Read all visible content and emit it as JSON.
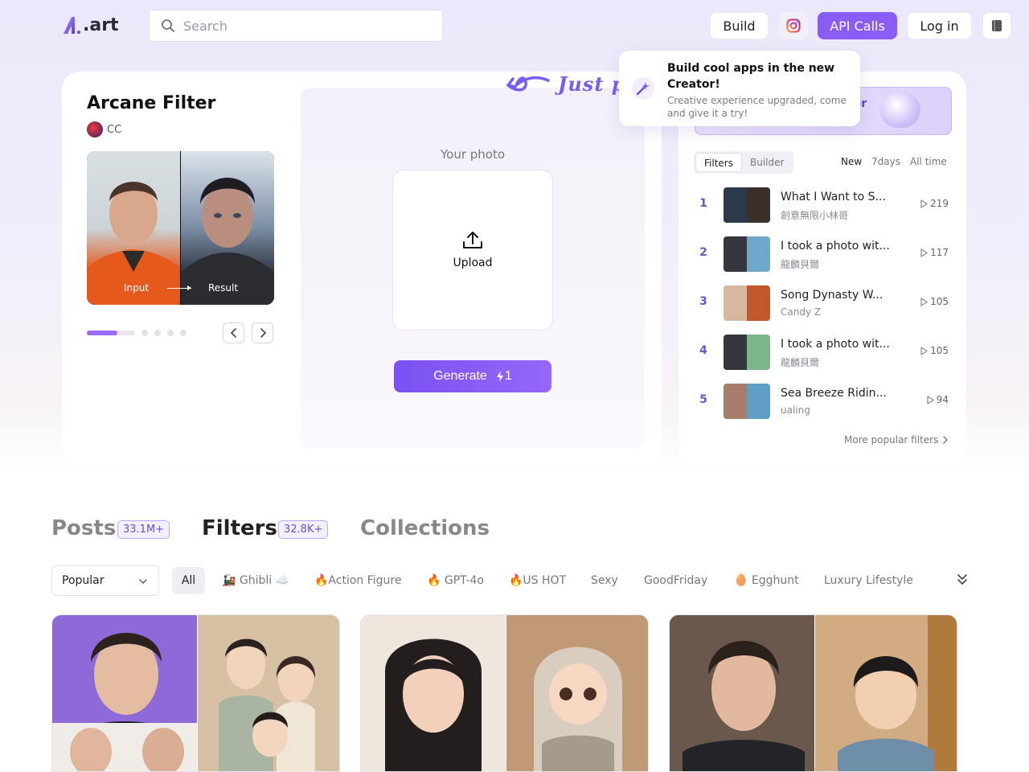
{
  "header": {
    "logo_text": ".art",
    "search_placeholder": "Search",
    "build_label": "Build",
    "api_label": "API Calls",
    "login_label": "Log in"
  },
  "tooltip": {
    "title": "Build cool apps in the new Creator!",
    "body": "Creative experience upgraded, come and give it a try!"
  },
  "annotation": {
    "text": "Just p"
  },
  "filter": {
    "title": "Arcane Filter",
    "author": "CC",
    "input_label": "Input",
    "result_label": "Result",
    "your_photo_label": "Your photo",
    "upload_label": "Upload",
    "generate_label": "Generate",
    "generate_cost": "1",
    "carousel": {
      "total_slides": 5,
      "active_slide": 1
    }
  },
  "right_panel": {
    "banner_text": "ler",
    "segments": [
      "Filters",
      "Builder"
    ],
    "active_segment": "Filters",
    "time_filters": [
      "New",
      "7days",
      "All time"
    ],
    "active_time_filter": "New",
    "ranking": [
      {
        "rank": "1",
        "title": "What I Want to S...",
        "user": "創意無限小林哥",
        "count": "219",
        "colors": [
          "#2c3a4c",
          "#3b2f2a"
        ]
      },
      {
        "rank": "2",
        "title": "I took a photo wit...",
        "user": "龍麟貝爾",
        "count": "117",
        "colors": [
          "#36373d",
          "#6fa8c8"
        ]
      },
      {
        "rank": "3",
        "title": "Song Dynasty W...",
        "user": "Candy Z",
        "count": "105",
        "colors": [
          "#d6b8a0",
          "#c0582a"
        ]
      },
      {
        "rank": "4",
        "title": "I took a photo wit...",
        "user": "龍麟貝爾",
        "count": "105",
        "colors": [
          "#36373d",
          "#7bb58a"
        ]
      },
      {
        "rank": "5",
        "title": "Sea Breeze Ridin...",
        "user": "ualing",
        "count": "94",
        "colors": [
          "#a67c6a",
          "#5f9fc6"
        ]
      }
    ],
    "more_label": "More popular filters"
  },
  "tabs": [
    {
      "label": "Posts",
      "count": "33.1M+"
    },
    {
      "label": "Filters",
      "count": "32.8K+"
    },
    {
      "label": "Collections",
      "count": ""
    }
  ],
  "active_tab": "Filters",
  "sort": {
    "selected": "Popular"
  },
  "chips": [
    "All",
    "🚂 Ghibli ☁️",
    "🔥Action Figure",
    "🔥 GPT-4o",
    "🔥US HOT",
    "Sexy",
    "GoodFriday",
    "🥚 Egghunt",
    "Luxury Lifestyle"
  ],
  "active_chip": "All",
  "colors": {
    "accent": "#8a5cf6",
    "rank_number": "#6b55c9",
    "badge_text": "#6b4fd8"
  }
}
